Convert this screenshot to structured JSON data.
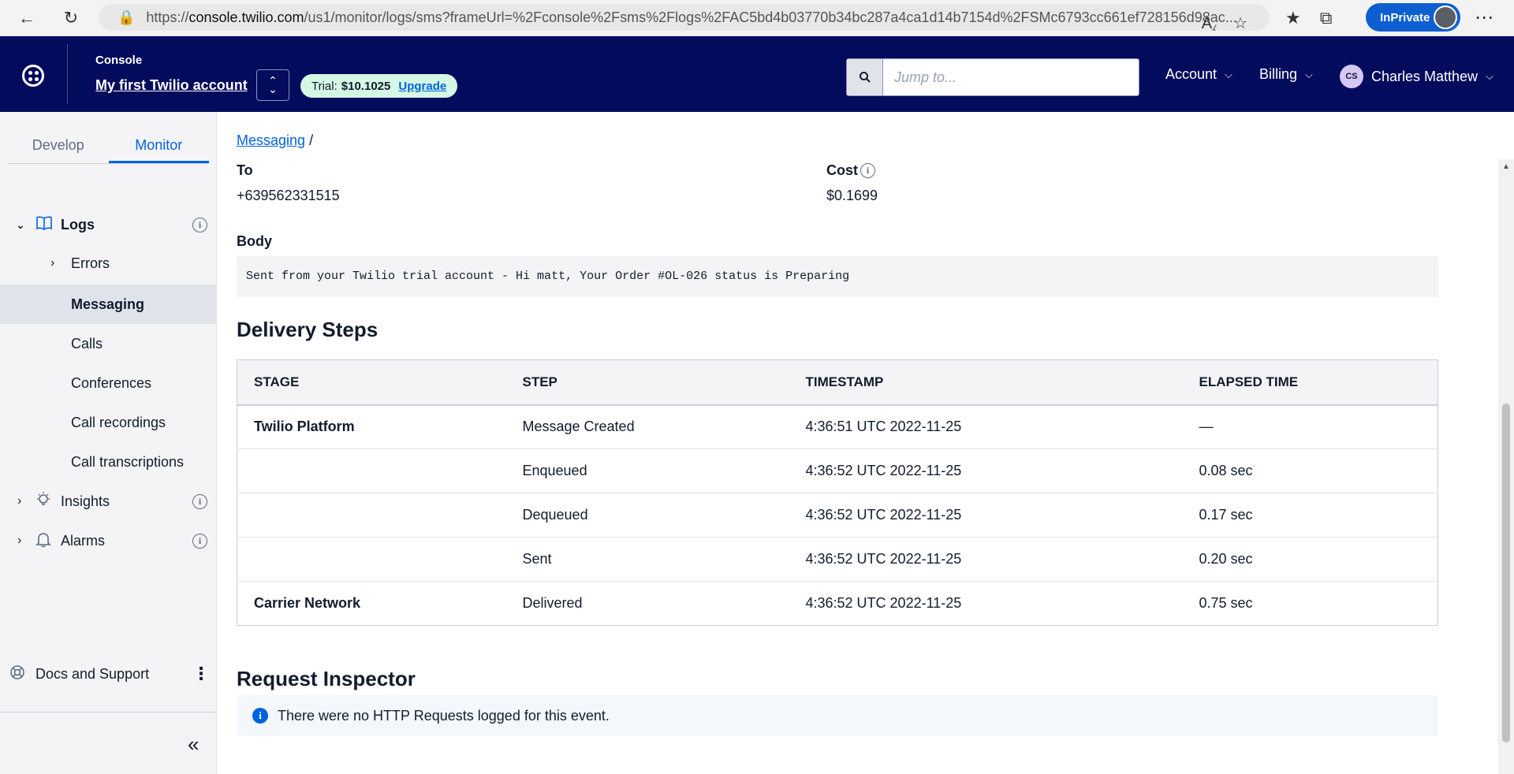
{
  "browser": {
    "url_prefix": "https://",
    "url_host": "console.twilio.com",
    "url_path": "/us1/monitor/logs/sms?frameUrl=%2Fconsole%2Fsms%2Flogs%2FAC5bd4b03770b34bc287a4ca1d14b7154d%2FSMc6793cc661ef728156d98ac...",
    "inprivate_label": "InPrivate"
  },
  "header": {
    "console_label": "Console",
    "account_name": "My first Twilio account",
    "trial_label": "Trial:",
    "trial_balance": "$10.1025",
    "upgrade_label": "Upgrade",
    "search_placeholder": "Jump to...",
    "account_menu": "Account",
    "billing_menu": "Billing",
    "user_initials": "CS",
    "user_name": "Charles Matthew"
  },
  "sidebar": {
    "tabs": [
      {
        "label": "Develop",
        "active": false
      },
      {
        "label": "Monitor",
        "active": true
      }
    ],
    "logs_label": "Logs",
    "errors_label": "Errors",
    "messaging_label": "Messaging",
    "calls_label": "Calls",
    "conferences_label": "Conferences",
    "call_recordings_label": "Call recordings",
    "call_transcriptions_label": "Call transcriptions",
    "insights_label": "Insights",
    "alarms_label": "Alarms",
    "docs_label": "Docs and Support"
  },
  "main": {
    "breadcrumb_link": "Messaging",
    "breadcrumb_sep": "/",
    "to_label": "To",
    "to_value": "+639562331515",
    "cost_label": "Cost",
    "cost_value": "$0.1699",
    "body_label": "Body",
    "body_text": "Sent from your Twilio trial account - Hi matt, Your Order #OL-026 status is Preparing",
    "delivery_title": "Delivery Steps",
    "table_headers": [
      "STAGE",
      "STEP",
      "TIMESTAMP",
      "ELAPSED TIME"
    ],
    "steps": [
      {
        "stage": "Twilio Platform",
        "step": "Message Created",
        "timestamp": "4:36:51 UTC 2022-11-25",
        "elapsed": "—"
      },
      {
        "stage": "",
        "step": "Enqueued",
        "timestamp": "4:36:52 UTC 2022-11-25",
        "elapsed": "0.08 sec"
      },
      {
        "stage": "",
        "step": "Dequeued",
        "timestamp": "4:36:52 UTC 2022-11-25",
        "elapsed": "0.17 sec"
      },
      {
        "stage": "",
        "step": "Sent",
        "timestamp": "4:36:52 UTC 2022-11-25",
        "elapsed": "0.20 sec"
      },
      {
        "stage": "Carrier Network",
        "step": "Delivered",
        "timestamp": "4:36:52 UTC 2022-11-25",
        "elapsed": "0.75 sec"
      }
    ],
    "inspector_title": "Request Inspector",
    "inspector_message": "There were no HTTP Requests logged for this event."
  },
  "colors": {
    "topbar_bg": "#030b5d",
    "link_blue": "#0263e0",
    "trial_pill_bg": "#d5f8e5",
    "sidebar_bg": "#f4f4f6"
  }
}
